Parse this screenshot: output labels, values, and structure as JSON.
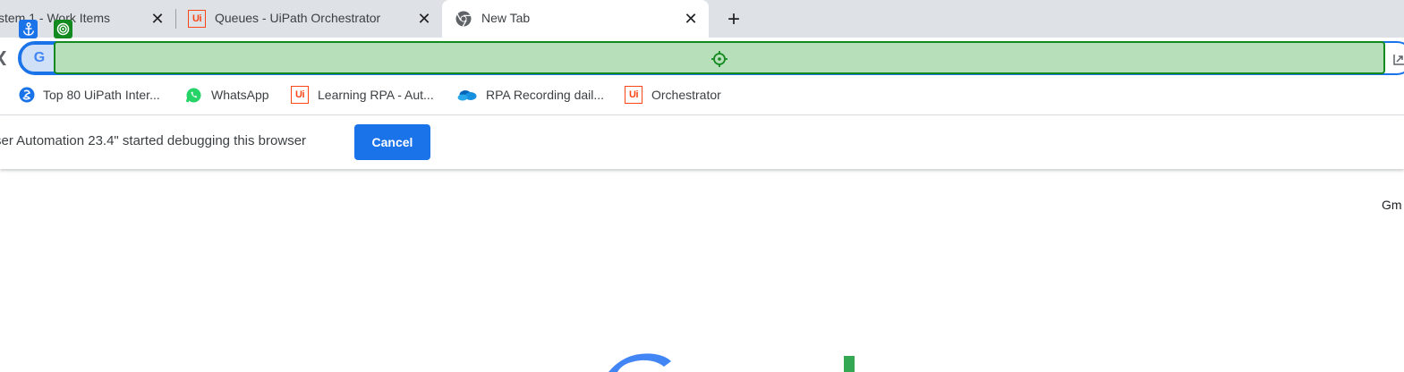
{
  "tabs": [
    {
      "title": "stem 1 - Work Items",
      "icon": "tab-icon-none",
      "active": false
    },
    {
      "title": "Queues - UiPath Orchestrator",
      "icon": "uipath-icon",
      "active": false
    },
    {
      "title": "New Tab",
      "icon": "chrome-icon",
      "active": true
    }
  ],
  "tab_close_glyph": "✕",
  "new_tab_glyph": "+",
  "icons": {
    "uipath_text": "Ui",
    "google_text": "G"
  },
  "bookmarks": [
    {
      "label": "Top 80 UiPath Inter...",
      "icon": "site-icon"
    },
    {
      "label": "WhatsApp",
      "icon": "whatsapp-icon"
    },
    {
      "label": "Learning RPA - Aut...",
      "icon": "uipath-icon"
    },
    {
      "label": "RPA Recording dail...",
      "icon": "onedrive-icon"
    },
    {
      "label": "Orchestrator",
      "icon": "uipath-icon"
    }
  ],
  "infobar": {
    "message": "ser Automation 23.4\" started debugging this browser",
    "cancel_label": "Cancel"
  },
  "page": {
    "gmail_link": "Gm"
  },
  "colors": {
    "accent": "#1a73e8",
    "target_green": "#138a1f",
    "target_fill": "#b7dfba",
    "uipath_orange": "#fa4616",
    "tabstrip_bg": "#dee1e6"
  }
}
